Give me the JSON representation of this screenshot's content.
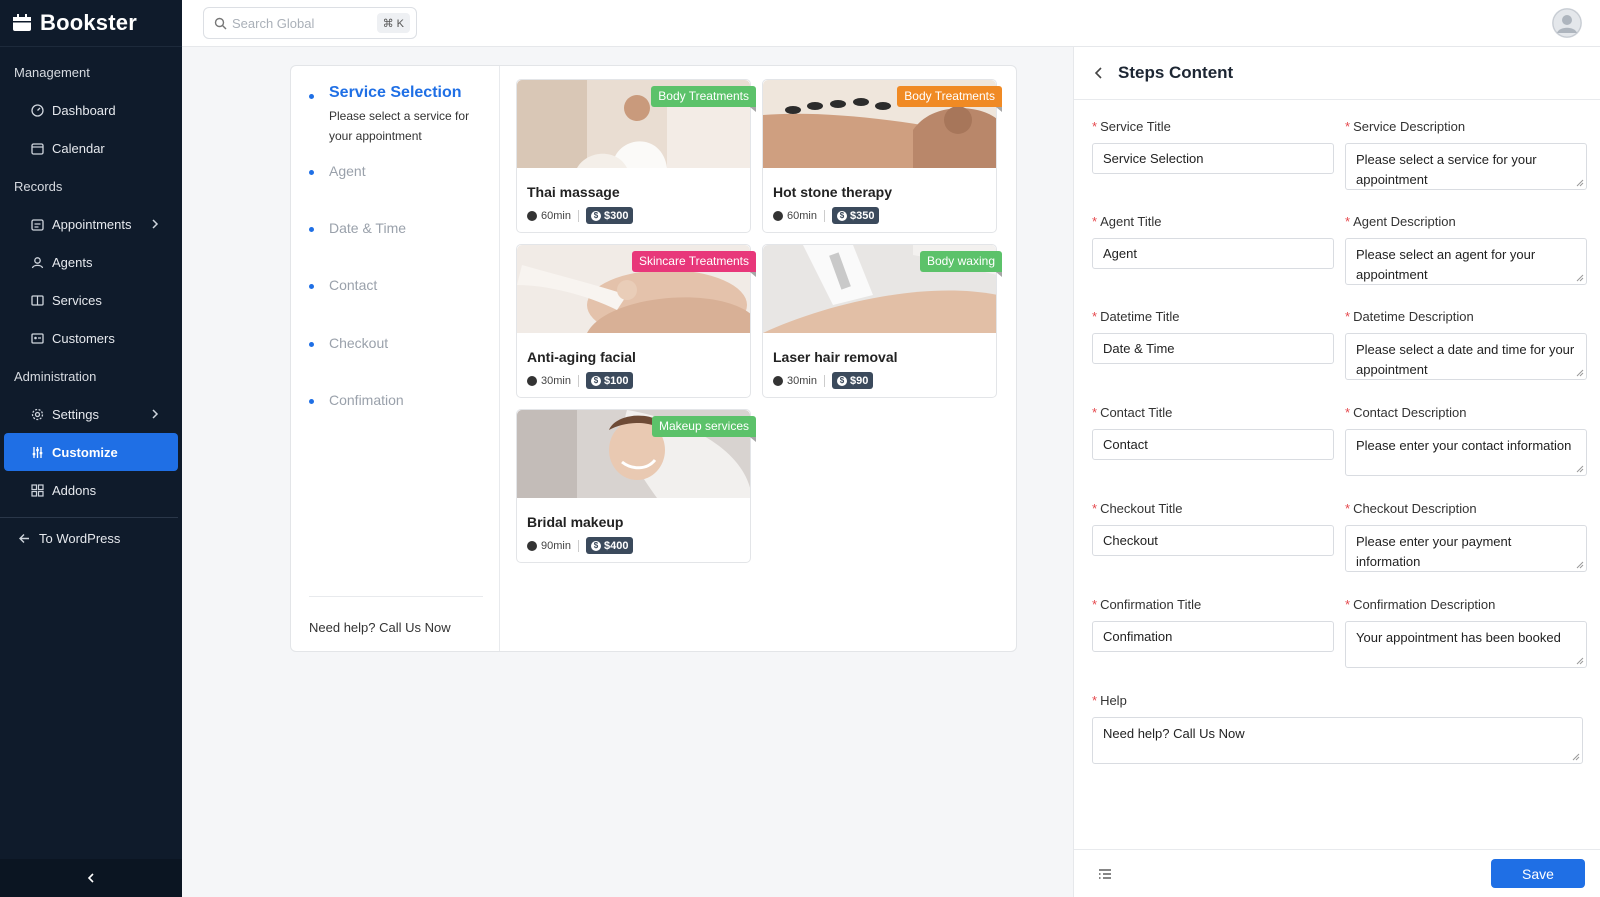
{
  "app": {
    "name": "Bookster"
  },
  "search": {
    "placeholder": "Search Global",
    "shortcut": "⌘ K"
  },
  "sidebar": {
    "sections": [
      {
        "label": "Management",
        "items": [
          {
            "label": "Dashboard",
            "icon": "dashboard-icon"
          },
          {
            "label": "Calendar",
            "icon": "calendar-icon"
          }
        ]
      },
      {
        "label": "Records",
        "items": [
          {
            "label": "Appointments",
            "icon": "appointments-icon",
            "has_submenu": true
          },
          {
            "label": "Agents",
            "icon": "agents-icon"
          },
          {
            "label": "Services",
            "icon": "services-icon"
          },
          {
            "label": "Customers",
            "icon": "customers-icon"
          }
        ]
      },
      {
        "label": "Administration",
        "items": [
          {
            "label": "Settings",
            "icon": "gear-icon",
            "has_submenu": true
          },
          {
            "label": "Customize",
            "icon": "customize-icon",
            "active": true
          },
          {
            "label": "Addons",
            "icon": "addons-icon"
          }
        ]
      }
    ],
    "to_wordpress": "To WordPress"
  },
  "preview": {
    "steps": [
      {
        "title": "Service Selection",
        "description": "Please select a service for your appointment",
        "active": true
      },
      {
        "title": "Agent"
      },
      {
        "title": "Date & Time"
      },
      {
        "title": "Contact"
      },
      {
        "title": "Checkout"
      },
      {
        "title": "Confimation"
      }
    ],
    "help": "Need help? Call Us Now",
    "services": [
      {
        "name": "Thai massage",
        "category": "Body Treatments",
        "tag_color": "#5cc26a",
        "duration": "60min",
        "price": "$300"
      },
      {
        "name": "Hot stone therapy",
        "category": "Body Treatments",
        "tag_color": "#f08a24",
        "duration": "60min",
        "price": "$350"
      },
      {
        "name": "Anti-aging facial",
        "category": "Skincare Treatments",
        "tag_color": "#e8377a",
        "duration": "30min",
        "price": "$100"
      },
      {
        "name": "Laser hair removal",
        "category": "Body waxing",
        "tag_color": "#5cc26a",
        "duration": "30min",
        "price": "$90"
      },
      {
        "name": "Bridal makeup",
        "category": "Makeup services",
        "tag_color": "#5cc26a",
        "duration": "90min",
        "price": "$400"
      }
    ]
  },
  "panel": {
    "title": "Steps Content",
    "fields": {
      "service_title": {
        "label": "Service Title",
        "value": "Service Selection"
      },
      "service_desc": {
        "label": "Service Description",
        "value": "Please select a service for your appointment"
      },
      "agent_title": {
        "label": "Agent Title",
        "value": "Agent"
      },
      "agent_desc": {
        "label": "Agent Description",
        "value": "Please select an agent for your appointment"
      },
      "datetime_title": {
        "label": "Datetime Title",
        "value": "Date & Time"
      },
      "datetime_desc": {
        "label": "Datetime Description",
        "value": "Please select a date and time for your appointment"
      },
      "contact_title": {
        "label": "Contact Title",
        "value": "Contact"
      },
      "contact_desc": {
        "label": "Contact Description",
        "value": "Please enter your contact information"
      },
      "checkout_title": {
        "label": "Checkout Title",
        "value": "Checkout"
      },
      "checkout_desc": {
        "label": "Checkout Description",
        "value": "Please enter your payment information"
      },
      "confirmation_title": {
        "label": "Confirmation Title",
        "value": "Confimation"
      },
      "confirmation_desc": {
        "label": "Confirmation Description",
        "value": "Your appointment has been booked"
      },
      "help": {
        "label": "Help",
        "value": "Need help? Call Us Now"
      }
    },
    "save_label": "Save"
  },
  "colors": {
    "sidebar_bg": "#0f1b2b",
    "accent": "#1f6fe5"
  }
}
